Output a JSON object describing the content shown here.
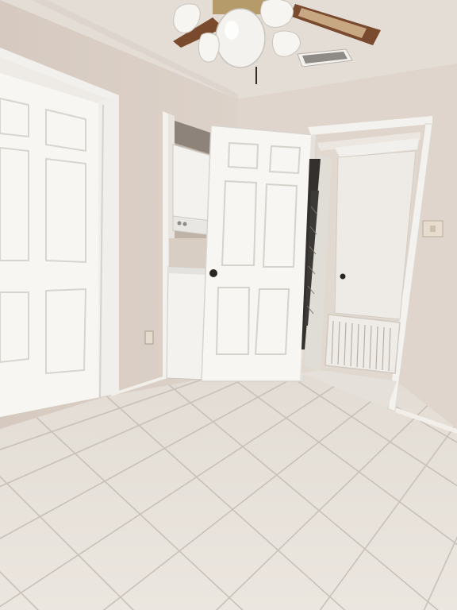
{
  "scene": {
    "alt": "",
    "colors": {
      "wall": "#dcd1c8",
      "wall_shadow": "#cbbfb5",
      "ceiling": "#e4ddd6",
      "floor": "#e6e1da",
      "grout": "#c9c1b7",
      "trim": "#f5f3ef",
      "door": "#f7f6f3",
      "door_panel_shadow": "#d9d6d0",
      "fan_blade": "#7a4a2e",
      "washer": "#f3f2ef"
    },
    "objects": [
      "ceiling-fan-icon",
      "air-vent-icon",
      "closet-door",
      "laundry-nook",
      "stacked-washer-dryer",
      "bedroom-door",
      "hallway-door",
      "return-air-grille",
      "light-switch",
      "electrical-outlet",
      "tile-floor"
    ]
  }
}
